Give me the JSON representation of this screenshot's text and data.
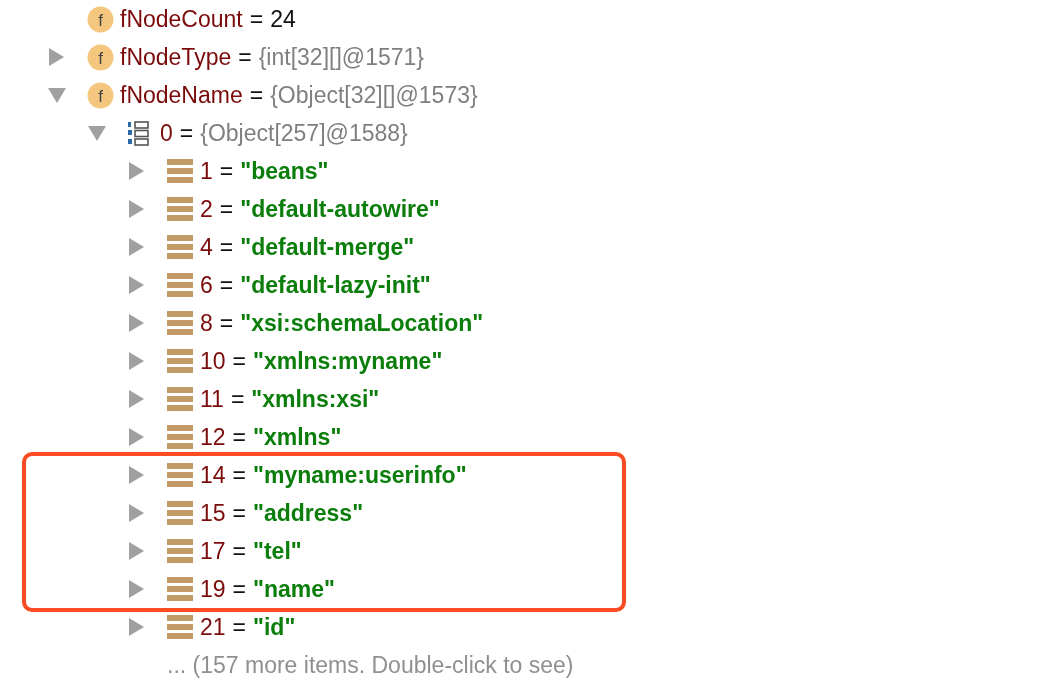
{
  "tree": [
    {
      "kind": "field",
      "icon_label": "f",
      "name": "fNodeCount",
      "separator": "=",
      "value": {
        "kind": "number",
        "text": "24"
      }
    },
    {
      "kind": "field",
      "icon_label": "f",
      "name": "fNodeType",
      "separator": "=",
      "value": {
        "kind": "object",
        "text": "{int[32][]@1571}"
      },
      "expanded": false
    },
    {
      "kind": "field",
      "icon_label": "f",
      "name": "fNodeName",
      "separator": "=",
      "value": {
        "kind": "object",
        "text": "{Object[32][]@1573}"
      },
      "expanded": true,
      "children": [
        {
          "kind": "array",
          "name": "0",
          "separator": "=",
          "value": {
            "kind": "object",
            "text": "{Object[257]@1588}"
          },
          "expanded": true,
          "children": [
            {
              "kind": "element",
              "name": "1",
              "separator": "=",
              "value": {
                "kind": "string",
                "text": "\"beans\""
              },
              "expanded": false
            },
            {
              "kind": "element",
              "name": "2",
              "separator": "=",
              "value": {
                "kind": "string",
                "text": "\"default-autowire\""
              },
              "expanded": false
            },
            {
              "kind": "element",
              "name": "4",
              "separator": "=",
              "value": {
                "kind": "string",
                "text": "\"default-merge\""
              },
              "expanded": false
            },
            {
              "kind": "element",
              "name": "6",
              "separator": "=",
              "value": {
                "kind": "string",
                "text": "\"default-lazy-init\""
              },
              "expanded": false
            },
            {
              "kind": "element",
              "name": "8",
              "separator": "=",
              "value": {
                "kind": "string",
                "text": "\"xsi:schemaLocation\""
              },
              "expanded": false
            },
            {
              "kind": "element",
              "name": "10",
              "separator": "=",
              "value": {
                "kind": "string",
                "text": "\"xmlns:myname\""
              },
              "expanded": false
            },
            {
              "kind": "element",
              "name": "11",
              "separator": "=",
              "value": {
                "kind": "string",
                "text": "\"xmlns:xsi\""
              },
              "expanded": false
            },
            {
              "kind": "element",
              "name": "12",
              "separator": "=",
              "value": {
                "kind": "string",
                "text": "\"xmlns\""
              },
              "expanded": false
            },
            {
              "kind": "element",
              "name": "14",
              "separator": "=",
              "value": {
                "kind": "string",
                "text": "\"myname:userinfo\""
              },
              "expanded": false,
              "highlighted": true
            },
            {
              "kind": "element",
              "name": "15",
              "separator": "=",
              "value": {
                "kind": "string",
                "text": "\"address\""
              },
              "expanded": false,
              "highlighted": true
            },
            {
              "kind": "element",
              "name": "17",
              "separator": "=",
              "value": {
                "kind": "string",
                "text": "\"tel\""
              },
              "expanded": false,
              "highlighted": true
            },
            {
              "kind": "element",
              "name": "19",
              "separator": "=",
              "value": {
                "kind": "string",
                "text": "\"name\""
              },
              "expanded": false,
              "highlighted": true
            },
            {
              "kind": "element",
              "name": "21",
              "separator": "=",
              "value": {
                "kind": "string",
                "text": "\"id\""
              },
              "expanded": false
            },
            {
              "kind": "more",
              "text": "... (157 more items. Double-click to see)"
            }
          ]
        }
      ]
    }
  ]
}
